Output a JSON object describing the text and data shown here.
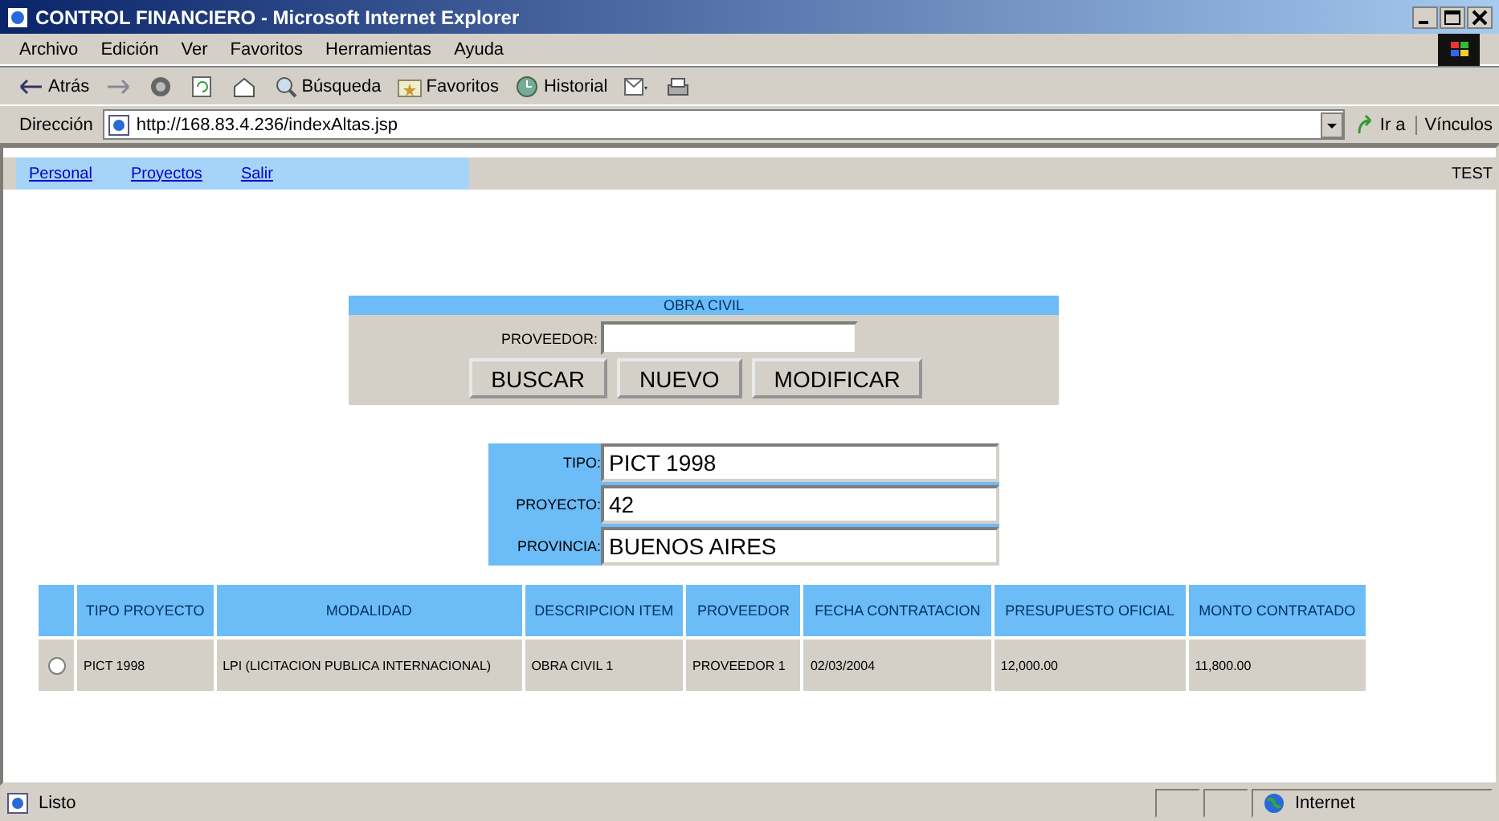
{
  "window": {
    "title": "CONTROL FINANCIERO - Microsoft Internet Explorer"
  },
  "menu": [
    "Archivo",
    "Edición",
    "Ver",
    "Favoritos",
    "Herramientas",
    "Ayuda"
  ],
  "toolbar": [
    {
      "kind": "back",
      "label": "Atrás"
    },
    {
      "kind": "forward"
    },
    {
      "kind": "stop"
    },
    {
      "kind": "refresh"
    },
    {
      "kind": "home"
    },
    {
      "kind": "search",
      "label": "Búsqueda"
    },
    {
      "kind": "favorites",
      "label": "Favoritos"
    },
    {
      "kind": "history",
      "label": "Historial"
    },
    {
      "kind": "mail"
    },
    {
      "kind": "print"
    }
  ],
  "address": {
    "label": "Dirección",
    "url": "http://168.83.4.236/indexAltas.jsp",
    "go": "Ir a",
    "links": "Vínculos"
  },
  "nav": {
    "links": [
      "Personal",
      "Proyectos",
      "Salir"
    ],
    "user": "TEST"
  },
  "search_form": {
    "title": "OBRA CIVIL",
    "field_label": "PROVEEDOR:",
    "buttons": [
      "BUSCAR",
      "NUEVO",
      "MODIFICAR"
    ]
  },
  "details": [
    {
      "label": "TIPO:",
      "value": "PICT 1998"
    },
    {
      "label": "PROYECTO:",
      "value": "42"
    },
    {
      "label": "PROVINCIA:",
      "value": "BUENOS AIRES"
    }
  ],
  "table": {
    "columns": [
      "TIPO PROYECTO",
      "MODALIDAD",
      "DESCRIPCION ITEM",
      "PROVEEDOR",
      "FECHA CONTRATACION",
      "PRESUPUESTO OFICIAL",
      "MONTO CONTRATADO"
    ],
    "rows": [
      {
        "selected": false,
        "cells": [
          "PICT 1998",
          "LPI (LICITACION PUBLICA INTERNACIONAL)",
          "OBRA CIVIL 1",
          "PROVEEDOR 1",
          "02/03/2004",
          "12,000.00",
          "11,800.00"
        ]
      }
    ]
  },
  "status_bar": {
    "text": "Listo",
    "zone": "Internet"
  }
}
